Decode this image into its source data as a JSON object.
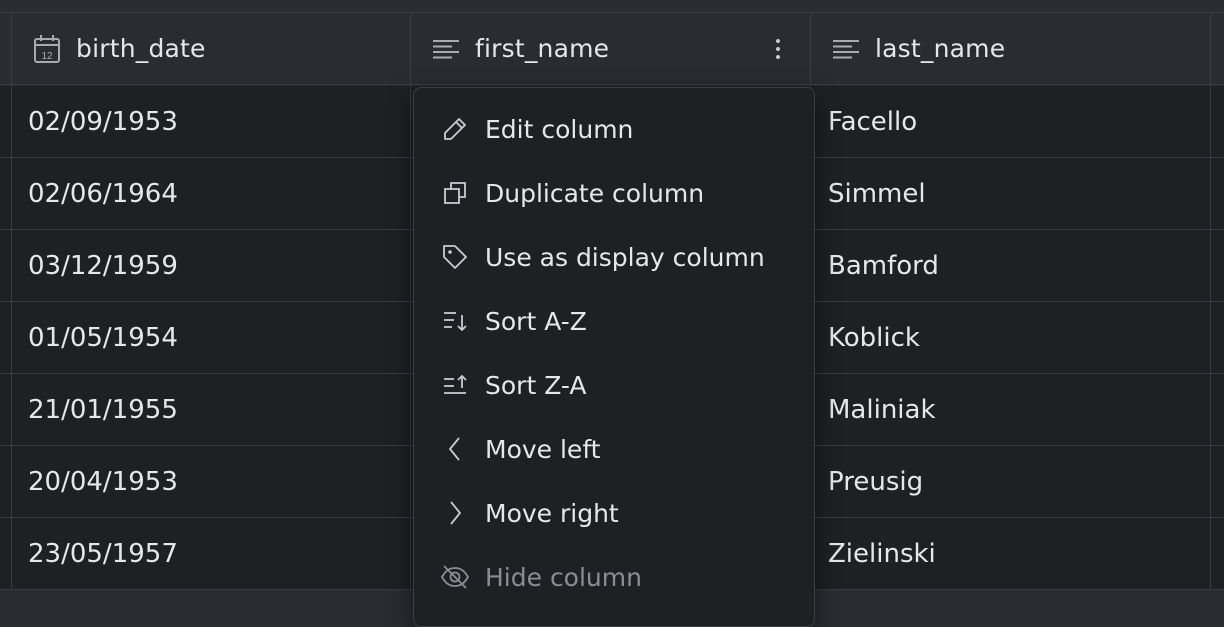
{
  "columns": [
    {
      "name": "birth_date",
      "icon": "calendar-icon"
    },
    {
      "name": "first_name",
      "icon": "text-lines-icon"
    },
    {
      "name": "last_name",
      "icon": "text-lines-icon"
    }
  ],
  "calendar_day": "12",
  "rows": [
    {
      "birth_date": "02/09/1953",
      "last_name": "Facello"
    },
    {
      "birth_date": "02/06/1964",
      "last_name": "Simmel"
    },
    {
      "birth_date": "03/12/1959",
      "last_name": "Bamford"
    },
    {
      "birth_date": "01/05/1954",
      "last_name": "Koblick"
    },
    {
      "birth_date": "21/01/1955",
      "last_name": "Maliniak"
    },
    {
      "birth_date": "20/04/1953",
      "last_name": "Preusig"
    },
    {
      "birth_date": "23/05/1957",
      "last_name": "Zielinski"
    }
  ],
  "column_menu": {
    "items": [
      {
        "label": "Edit column",
        "icon": "pencil-icon",
        "disabled": false
      },
      {
        "label": "Duplicate column",
        "icon": "duplicate-icon",
        "disabled": false
      },
      {
        "label": "Use as display column",
        "icon": "tag-icon",
        "disabled": false
      },
      {
        "label": "Sort A-Z",
        "icon": "sort-ascending-icon",
        "disabled": false
      },
      {
        "label": "Sort Z-A",
        "icon": "sort-descending-icon",
        "disabled": false
      },
      {
        "label": "Move left",
        "icon": "chevron-left-icon",
        "disabled": false
      },
      {
        "label": "Move right",
        "icon": "chevron-right-icon",
        "disabled": false
      },
      {
        "label": "Hide column",
        "icon": "eye-off-icon",
        "disabled": true
      }
    ]
  },
  "colors": {
    "background": "#2a2c31",
    "cell": "#1f2024",
    "border": "#3a3c42",
    "text": "#e6e7ea",
    "muted": "#8b8d94"
  }
}
